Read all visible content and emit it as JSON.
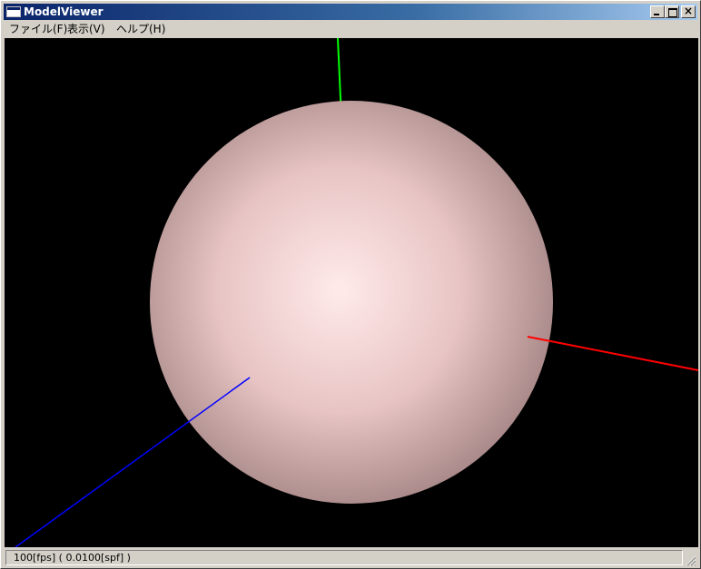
{
  "window": {
    "title": "ModelViewer",
    "controls": {
      "minimize": "minimize-icon",
      "maximize": "maximize-icon",
      "close": "close-icon"
    }
  },
  "menu": {
    "items": [
      {
        "label": "ファイル(F)"
      },
      {
        "label": "表示(V)"
      },
      {
        "label": "ヘルプ(H)"
      }
    ]
  },
  "viewport": {
    "background": "#000000",
    "sphere": {
      "highlight": "#ffeaea",
      "base": "#e8c4c4",
      "shadow": "#a88888"
    },
    "axes": [
      {
        "axis": "x",
        "color": "#ff0000"
      },
      {
        "axis": "y",
        "color": "#00ff00"
      },
      {
        "axis": "z",
        "color": "#0000ff"
      }
    ]
  },
  "status": {
    "text": "100[fps] ( 0.0100[spf] )"
  }
}
